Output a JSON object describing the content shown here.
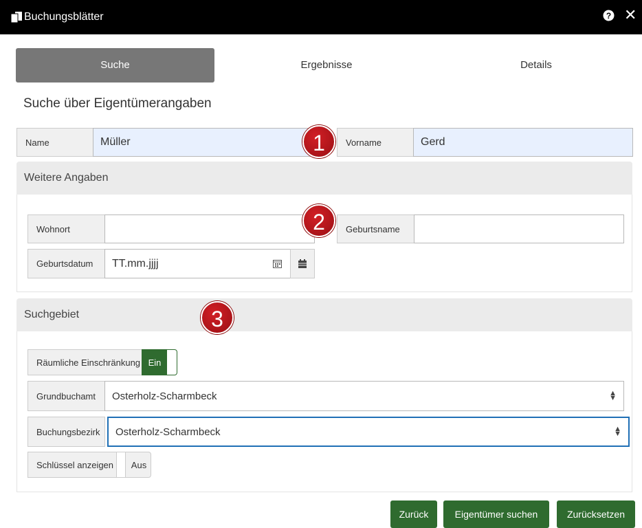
{
  "window": {
    "title": "Buchungsblätter",
    "app_icon": "documents-icon",
    "help_icon": "help-icon",
    "close_icon": "close-icon"
  },
  "tabs": [
    {
      "label": "Suche",
      "active": true
    },
    {
      "label": "Ergebnisse",
      "active": false
    },
    {
      "label": "Details",
      "active": false
    }
  ],
  "heading": "Suche über Eigentümerangaben",
  "owner": {
    "name_label": "Name",
    "name_value": "Müller",
    "vorname_label": "Vorname",
    "vorname_value": "Gerd"
  },
  "weitere": {
    "header": "Weitere Angaben",
    "wohnort_label": "Wohnort",
    "wohnort_value": "",
    "geburtsname_label": "Geburtsname",
    "geburtsname_value": "",
    "geburtsdatum_label": "Geburtsdatum",
    "geburtsdatum_placeholder": "TT.mm.jjjj"
  },
  "suchgebiet": {
    "header": "Suchgebiet",
    "raeumlich_label": "Räumliche Einschränkung",
    "raeumlich_state": "Ein",
    "grundbuchamt_label": "Grundbuchamt",
    "grundbuchamt_value": "Osterholz-Scharmbeck",
    "buchungsbezirk_label": "Buchungsbezirk",
    "buchungsbezirk_value": "Osterholz-Scharmbeck",
    "schluessel_label": "Schlüssel anzeigen",
    "schluessel_state": "Aus"
  },
  "markers": [
    "1",
    "2",
    "3"
  ],
  "buttons": {
    "zurueck": "Zurück",
    "suchen": "Eigentümer suchen",
    "zuruecksetzen": "Zurücksetzen"
  },
  "colors": {
    "accent_green": "#2f6b2f",
    "active_tab": "#777777",
    "marker_red": "#c0181e",
    "focus_blue": "#1f6fb5"
  }
}
